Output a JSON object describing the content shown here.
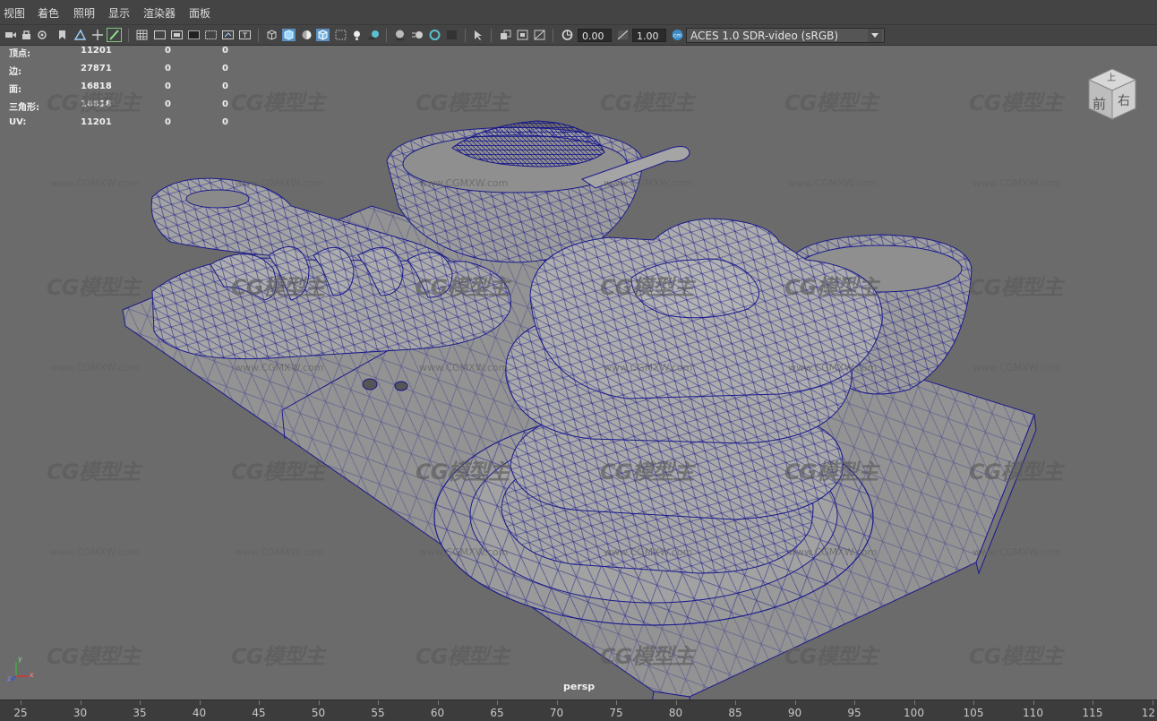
{
  "menu": [
    "视图",
    "着色",
    "照明",
    "显示",
    "渲染器",
    "面板"
  ],
  "toolbar": {
    "exposure_value": "0.00",
    "gamma_value": "1.00",
    "color_space": "ACES 1.0 SDR-video (sRGB)",
    "icons": [
      "camera-icon",
      "camera-attributes-icon",
      "bookmark-icon",
      "image-plane-icon",
      "grid-icon",
      "film-gate-icon",
      "resolution-gate-icon",
      "wireframe-icon",
      "smooth-shade-icon",
      "textured-icon",
      "lights-icon",
      "shadows-icon",
      "xray-icon",
      "isolate-icon",
      "exposure-icon",
      "gamma-icon",
      "color-management-icon"
    ]
  },
  "hud": {
    "rows": [
      {
        "label": "顶点:",
        "v1": "11201",
        "v2": "0",
        "v3": "0"
      },
      {
        "label": "边:",
        "v1": "27871",
        "v2": "0",
        "v3": "0"
      },
      {
        "label": "面:",
        "v1": "16818",
        "v2": "0",
        "v3": "0"
      },
      {
        "label": "三角形:",
        "v1": "16818",
        "v2": "0",
        "v3": "0"
      },
      {
        "label": "UV:",
        "v1": "11201",
        "v2": "0",
        "v3": "0"
      }
    ]
  },
  "viewport": {
    "camera_label": "persp",
    "viewcube": {
      "top": "上",
      "front": "前",
      "right": "右"
    },
    "watermark_text": "CG模型主",
    "watermark_url": "www.CGMXW.com",
    "wire_color": "#1a1a8c",
    "background_color": "#6b6b6b"
  },
  "axis": {
    "x": "x",
    "y": "y",
    "z": "z"
  },
  "ruler": {
    "ticks": [
      "25",
      "30",
      "35",
      "40",
      "45",
      "50",
      "55",
      "60",
      "65",
      "70",
      "75",
      "80",
      "85",
      "90",
      "95",
      "100",
      "105",
      "110",
      "115",
      "12"
    ]
  }
}
